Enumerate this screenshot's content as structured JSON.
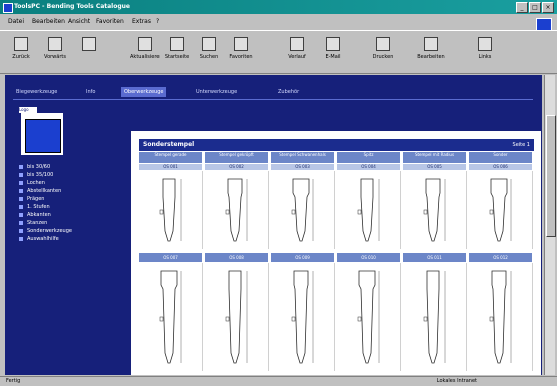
{
  "window": {
    "title": "ToolsPC - Bending Tools Catalogue",
    "buttons": [
      "_",
      "□",
      "×"
    ]
  },
  "menu": [
    "Datei",
    "Bearbeiten",
    "Ansicht",
    "Favoriten",
    "Extras",
    "?"
  ],
  "toolbar": [
    {
      "icon": "back-icon",
      "label": "Zurück"
    },
    {
      "icon": "forward-icon",
      "label": "Vorwärts"
    },
    {
      "icon": "stop-icon",
      "label": ""
    },
    {
      "icon": "refresh-icon",
      "label": "Aktualisieren"
    },
    {
      "icon": "home-icon",
      "label": "Startseite"
    },
    {
      "icon": "search-icon",
      "label": "Suchen"
    },
    {
      "icon": "favorites-icon",
      "label": "Favoriten"
    },
    {
      "icon": "history-icon",
      "label": "Verlauf"
    },
    {
      "icon": "mail-icon",
      "label": "E-Mail"
    },
    {
      "icon": "print-icon",
      "label": "Drucken"
    },
    {
      "icon": "edit-icon",
      "label": "Bearbeiten"
    },
    {
      "icon": "links-icon",
      "label": "Links"
    }
  ],
  "nav_tabs": [
    {
      "label": "Biegewerkzeuge",
      "active": false
    },
    {
      "label": "Info",
      "active": false
    },
    {
      "label": "Oberwerkzeuge",
      "active": true
    },
    {
      "label": "Unterwerkzeuge",
      "active": false
    },
    {
      "label": "Zubehör",
      "active": false
    }
  ],
  "sidebar": {
    "logo_tag": "Logo",
    "items": [
      "bis 30/60",
      "bis 35/100",
      "Lochen",
      "Abstellkanten",
      "Prägen",
      "1. Stufen",
      "Abkanten",
      "Stanzen",
      "Sonderwerkzeuge",
      "Auswahlhilfe"
    ]
  },
  "panel": {
    "title": "Sonderstempel",
    "page": "Seite 1",
    "row1": [
      {
        "cat": "Stempel gerade",
        "code": "OS 001"
      },
      {
        "cat": "Stempel gekröpft",
        "code": "OS 002"
      },
      {
        "cat": "Stempel Schwanenhals",
        "code": "OS 003"
      },
      {
        "cat": "Spitz",
        "code": "OS 004"
      },
      {
        "cat": "Stempel mit Radius",
        "code": "OS 005"
      },
      {
        "cat": "Sonder",
        "code": "OS 006"
      }
    ],
    "row2": [
      {
        "code": "OS 007"
      },
      {
        "code": "OS 008"
      },
      {
        "code": "OS 009"
      },
      {
        "code": "OS 010"
      },
      {
        "code": "OS 011"
      },
      {
        "code": "OS 012"
      }
    ]
  },
  "status": {
    "text": "Fertig",
    "zone": "Lokales Intranet"
  },
  "colors": {
    "background": "#16207a",
    "accent": "#1b3fcf",
    "header": "#1b2c8e",
    "category": "#6c86c8"
  }
}
